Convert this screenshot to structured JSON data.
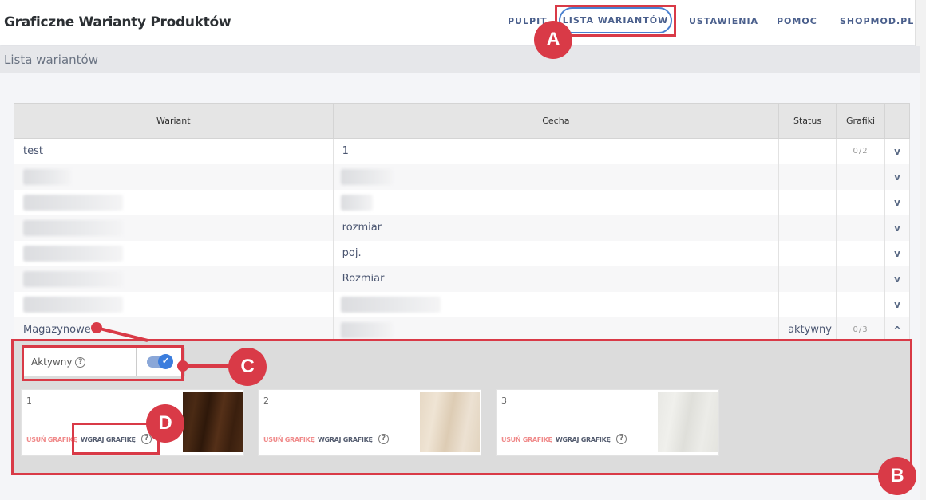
{
  "app_title": "Graficzne Warianty Produktów",
  "nav": {
    "pulpit": "PULPIT",
    "lista": "LISTA WARIANTÓW",
    "ustawienia": "USTAWIENIA",
    "pomoc": "POMOC",
    "shopmod": "SHOPMOD.PL"
  },
  "page_header": "Lista wariantów",
  "table": {
    "headers": {
      "wariant": "Wariant",
      "cecha": "Cecha",
      "status": "Status",
      "grafiki": "Grafiki"
    },
    "rows": [
      {
        "wariant": "test",
        "cecha": "1",
        "status": "",
        "grafiki": "0/2",
        "chevron": "v"
      },
      {
        "wariant": "",
        "cecha": "",
        "status": "",
        "grafiki": "",
        "chevron": "v"
      },
      {
        "wariant": "",
        "cecha": "",
        "status": "",
        "grafiki": "",
        "chevron": "v"
      },
      {
        "wariant": "",
        "cecha": "rozmiar",
        "status": "",
        "grafiki": "",
        "chevron": "v"
      },
      {
        "wariant": "",
        "cecha": "poj.",
        "status": "",
        "grafiki": "",
        "chevron": "v"
      },
      {
        "wariant": "",
        "cecha": "Rozmiar",
        "status": "",
        "grafiki": "",
        "chevron": "v"
      },
      {
        "wariant": "",
        "cecha": "",
        "status": "",
        "grafiki": "",
        "chevron": "v"
      },
      {
        "wariant": "Magazynowe",
        "cecha": "",
        "status": "aktywny",
        "grafiki": "0/3",
        "chevron": "^"
      }
    ]
  },
  "expanded": {
    "toggle_label": "Aktywny",
    "toggle_on": true,
    "help_glyph": "?",
    "cards": [
      {
        "num": "1",
        "delete": "USUŃ GRAFIKĘ",
        "upload": "WGRAJ GRAFIKĘ"
      },
      {
        "num": "2",
        "delete": "USUŃ GRAFIKĘ",
        "upload": "WGRAJ GRAFIKĘ"
      },
      {
        "num": "3",
        "delete": "USUŃ GRAFIKĘ",
        "upload": "WGRAJ GRAFIKĘ"
      }
    ]
  },
  "annotations": {
    "a": "A",
    "b": "B",
    "c": "C",
    "d": "D"
  },
  "colors": {
    "accent_red": "#d93a47",
    "nav_blue": "#4a5f8c",
    "toggle_blue": "#3b7ddd"
  }
}
